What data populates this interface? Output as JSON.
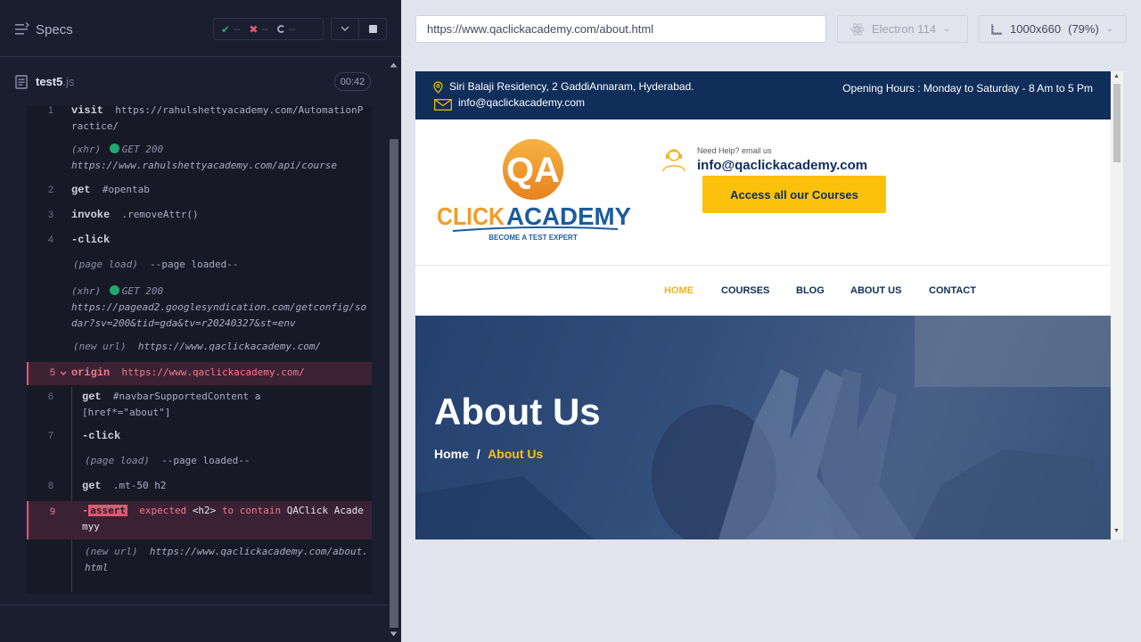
{
  "reporter": {
    "specs_label": "Specs",
    "stats": {
      "passed": "--",
      "failed": "--",
      "pending": "--"
    },
    "file": {
      "name": "test5",
      "ext": ".js",
      "duration": "00:42"
    }
  },
  "commands": [
    {
      "num": "1",
      "name": "visit",
      "msg": "https://rahulshettyacademy.com/AutomationPractice/"
    },
    {
      "xhr_label": "(xhr)",
      "status": "GET 200",
      "url": "https://www.rahulshettyacademy.com/api/course"
    },
    {
      "num": "2",
      "name": "get",
      "msg": "#opentab"
    },
    {
      "num": "3",
      "name": "invoke",
      "msg": ".removeAttr()"
    },
    {
      "num": "4",
      "name": "-click",
      "msg": ""
    },
    {
      "label": "(page load)",
      "msg": "--page loaded--"
    },
    {
      "xhr_label": "(xhr)",
      "status": "GET 200",
      "url": "https://pagead2.googlesyndication.com/getconfig/sodar?sv=200&tid=gda&tv=r20240327&st=env"
    },
    {
      "label": "(new url)",
      "msg": "https://www.qaclickacademy.com/"
    },
    {
      "num": "5",
      "name": "origin",
      "msg": "https://www.qaclickacademy.com/"
    },
    {
      "num": "6",
      "name": "get",
      "msg": "#navbarSupportedContent a[href*=\"about\"]"
    },
    {
      "num": "7",
      "name": "-click",
      "msg": ""
    },
    {
      "label": "(page load)",
      "msg": "--page loaded--"
    },
    {
      "num": "8",
      "name": "get",
      "msg": ".mt-50 h2"
    },
    {
      "num": "9",
      "name": "-",
      "badge": "assert",
      "msg_a": "expected",
      "msg_tag": "<h2>",
      "msg_b": "to contain",
      "msg_c": "QAClick Academyy"
    },
    {
      "label": "(new url)",
      "msg": "https://www.qaclickacademy.com/about.html"
    }
  ],
  "aut_header": {
    "url": "https://www.qaclickacademy.com/about.html",
    "browser": "Electron 114",
    "viewport": "1000x660",
    "scale": "(79%)"
  },
  "site": {
    "address": "Siri Balaji Residency, 2 GaddiAnnaram, Hyderabad.",
    "email_top": "info@qaclickacademy.com",
    "hours": "Opening Hours : Monday to Saturday - 8 Am to 5 Pm",
    "help_small": "Need Help? email us",
    "help_email": "info@qaclickacademy.com",
    "cta": "Access all our Courses",
    "logo_qa": "QA",
    "logo_click": "CLICK",
    "logo_academy": "ACADEMY",
    "logo_tagline": "BECOME A TEST EXPERT",
    "nav": [
      "HOME",
      "COURSES",
      "BLOG",
      "ABOUT US",
      "CONTACT"
    ],
    "hero_title": "About Us",
    "crumb_home": "Home",
    "crumb_sep": "/",
    "crumb_current": "About Us"
  },
  "colors": {
    "pass": "#1fa971",
    "fail": "#e45770",
    "accent": "#fcc10b",
    "navy": "#0f2e5a"
  }
}
